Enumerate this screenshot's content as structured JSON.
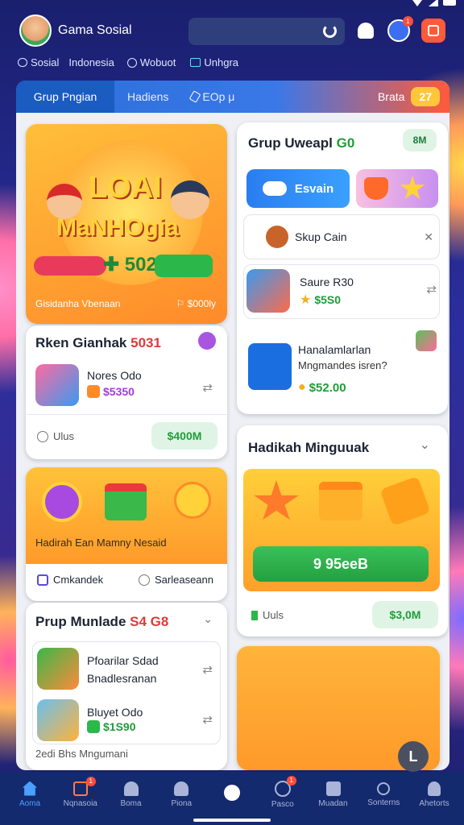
{
  "header": {
    "title": "Gama Sosial",
    "notif_badge": "1"
  },
  "subnav": [
    {
      "label": "Sosial",
      "icon": "chat-bubble-icon"
    },
    {
      "label": "Indonesia",
      "icon": "none"
    },
    {
      "label": "Wobuot",
      "icon": "clock-icon"
    },
    {
      "label": "Unhgra",
      "icon": "tv-icon"
    }
  ],
  "tabs": [
    {
      "label": "Grup Pngian"
    },
    {
      "label": "Hadiens"
    },
    {
      "label": "EOp μ"
    }
  ],
  "tab_badge_label": "Brata",
  "tab_badge_value": "27",
  "banner": {
    "title_top": "LOAI",
    "title_bottom": "MaNHOgia",
    "score": "502",
    "footer_left": "Gisidanha Vbenaan",
    "footer_right": "⚐ $000ly"
  },
  "game_card": {
    "title": "Rken Gianhak",
    "title_value": "5031",
    "item_name": "Nores Odo",
    "item_price": "$5350",
    "label": "Ulus",
    "button": "$400M"
  },
  "gift_card": {
    "caption": "Hadirah Ean Mamny Nesaid",
    "chip_left": "Cmkandek",
    "chip_right": "Sarleaseann"
  },
  "list_card": {
    "title": "Prup Munlade",
    "title_value": "S4 G8",
    "items": [
      {
        "line1": "Pfoarilar Sdad",
        "line2": "Bnadlesranan"
      },
      {
        "line1": "Bluyet Odo",
        "line2": "$1S90"
      }
    ],
    "footer": "2edi Bhs Mngumani"
  },
  "group_card": {
    "title": "Grup Uweapl",
    "title_value": "G0",
    "chip": "8M",
    "btn_blue": "Esvain",
    "rows": [
      {
        "name": "Skup Cain"
      },
      {
        "name": "Saure",
        "value": "R30",
        "price": "$5S0"
      },
      {
        "name": "Hanalamlarlan",
        "sub": "Mngmandes isren?",
        "price": "$52.00"
      }
    ]
  },
  "hadiah_card": {
    "title": "Hadikah Minguuak",
    "button": "9 95eeB",
    "label": "Uuls",
    "price": "$3,0M"
  },
  "bottom_nav": [
    {
      "label": "Aoma",
      "icon": "home-icon"
    },
    {
      "label": "Nqnasoia",
      "icon": "store-icon",
      "badge": "1"
    },
    {
      "label": "Boma",
      "icon": "bell-icon"
    },
    {
      "label": "Piona",
      "icon": "people-icon"
    },
    {
      "label": "",
      "icon": "center-dot-icon"
    },
    {
      "label": "Pasco",
      "icon": "game-icon",
      "badge": "1"
    },
    {
      "label": "Muadan",
      "icon": "doc-icon"
    },
    {
      "label": "Sonterns",
      "icon": "search-icon"
    },
    {
      "label": "Ahetorts",
      "icon": "user-icon"
    }
  ],
  "fab_glyph": "L",
  "colors": {
    "accent_orange": "#ff7a2a",
    "green": "#2cb74b",
    "blue": "#2a8cf0",
    "nav_bg": "#142a6e"
  }
}
